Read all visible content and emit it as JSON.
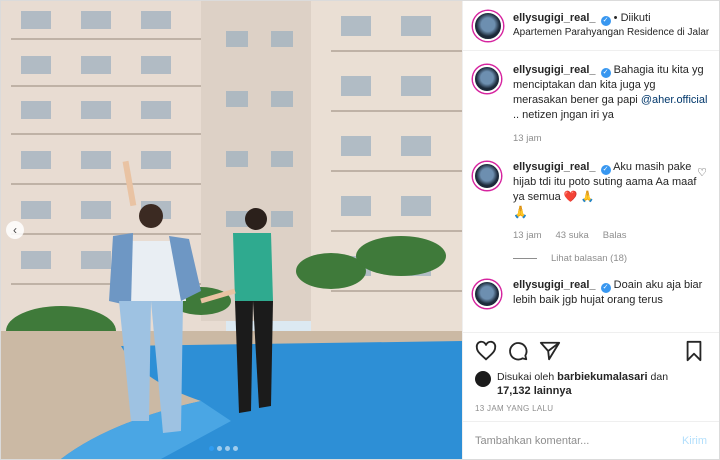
{
  "header": {
    "username": "ellysugigi_real_",
    "separator": "•",
    "follow_status": "Diikuti",
    "location": "Apartemen Parahyangan Residence di Jalan Ci..."
  },
  "comments": [
    {
      "username": "ellysugigi_real_",
      "text": "Bahagia itu kita yg menciptakan dan kita juga yg merasakan bener ga papi",
      "mention": "@aher.official",
      "text_after": " .. netizen jngan iri ya",
      "time": "13 jam"
    },
    {
      "username": "ellysugigi_real_",
      "text": "Aku masih pake hijab tdi itu poto suting aama Aa maaf ya semua ❤️ 🙏",
      "text_tail": "🙏",
      "time": "13 jam",
      "likes": "43 suka",
      "reply": "Balas",
      "view_replies": "Lihat balasan (18)"
    },
    {
      "username": "ellysugigi_real_",
      "text": "Doain aku aja biar lebih baik jgb hujat orang terus"
    }
  ],
  "likes": {
    "prefix": "Disukai oleh",
    "user": "barbiekumalasari",
    "conj": "dan",
    "count": "17,132 lainnya"
  },
  "timestamp": "13 JAM YANG LALU",
  "add_comment": {
    "placeholder": "Tambahkan komentar...",
    "send": "Kirim"
  },
  "icons": [
    "heart-icon",
    "comment-icon",
    "share-icon",
    "bookmark-icon",
    "chevron-left-icon",
    "verified-icon"
  ],
  "colors": {
    "verified": "#3897f0",
    "link": "#00376b",
    "send_disabled": "#b2dffc",
    "dot_active": "#2f9cf0"
  }
}
